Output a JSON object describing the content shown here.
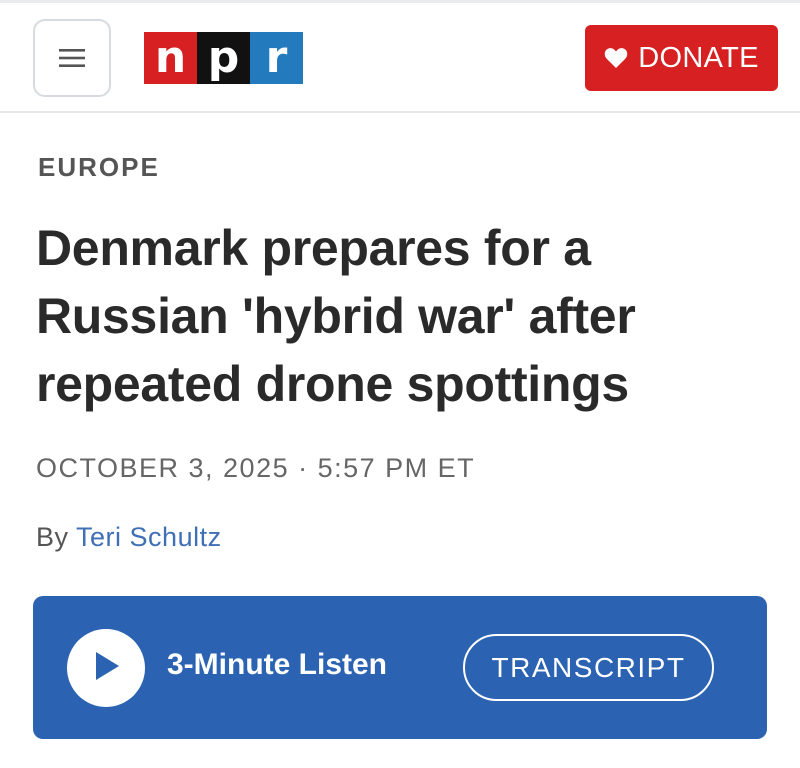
{
  "header": {
    "menu_icon": "hamburger-menu-icon",
    "logo": {
      "letters": [
        "n",
        "p",
        "r"
      ],
      "colors": [
        "#d62021",
        "#111111",
        "#237bbd"
      ]
    },
    "donate": {
      "label": "DONATE",
      "icon": "heart-icon",
      "color": "#d62021"
    }
  },
  "article": {
    "section": "EUROPE",
    "headline": "Denmark prepares for a Russian 'hybrid war' after repeated drone spottings",
    "dateline": "OCTOBER 3, 2025 · 5:57 PM ET",
    "byline": {
      "prefix": "By",
      "author": "Teri Schultz"
    }
  },
  "audio_player": {
    "play_icon": "play-icon",
    "listen_label": "3-Minute Listen",
    "transcript_label": "TRANSCRIPT",
    "color": "#2b62b1"
  }
}
